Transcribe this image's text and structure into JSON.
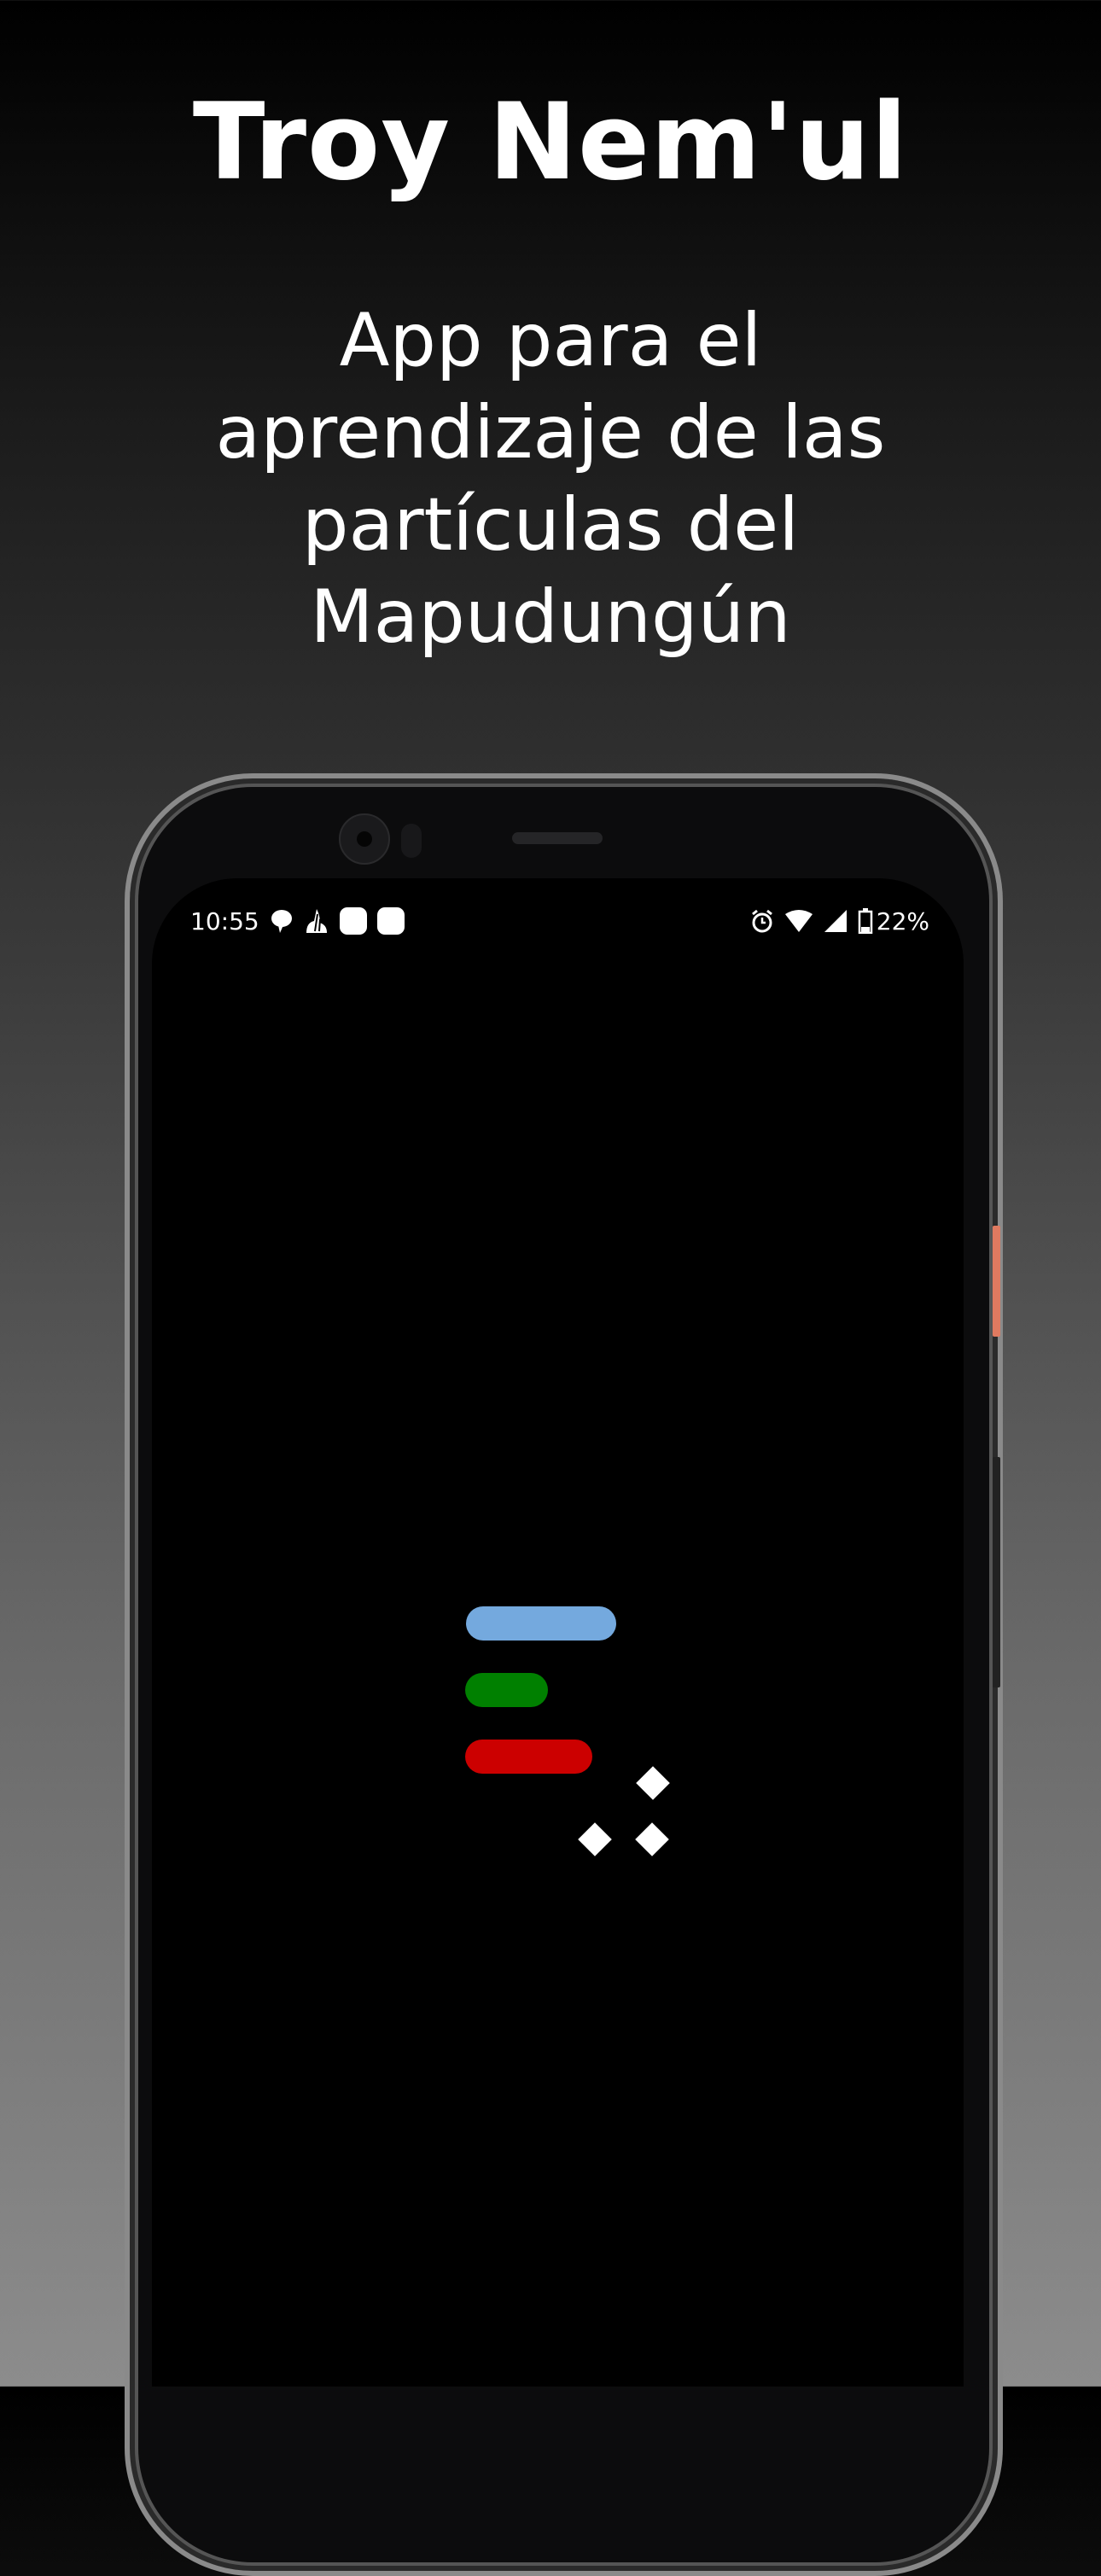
{
  "header": {
    "title": "Troy Nem'ul",
    "subtitle_lines": [
      "App para el",
      "aprendizaje de las",
      "partículas del",
      "Mapudungún"
    ]
  },
  "status_bar": {
    "time": "10:55",
    "left_icons": [
      "chat-bubble-icon",
      "flame-app-icon",
      "app-notification-icon",
      "app-notification-icon"
    ],
    "right_icons": [
      "alarm-icon",
      "wifi-icon",
      "signal-icon",
      "battery-icon"
    ],
    "battery": "22%"
  },
  "splash_logo": {
    "bar_colors": [
      "#74a9de",
      "#008000",
      "#cc0000"
    ],
    "diamond_color": "#ffffff"
  }
}
